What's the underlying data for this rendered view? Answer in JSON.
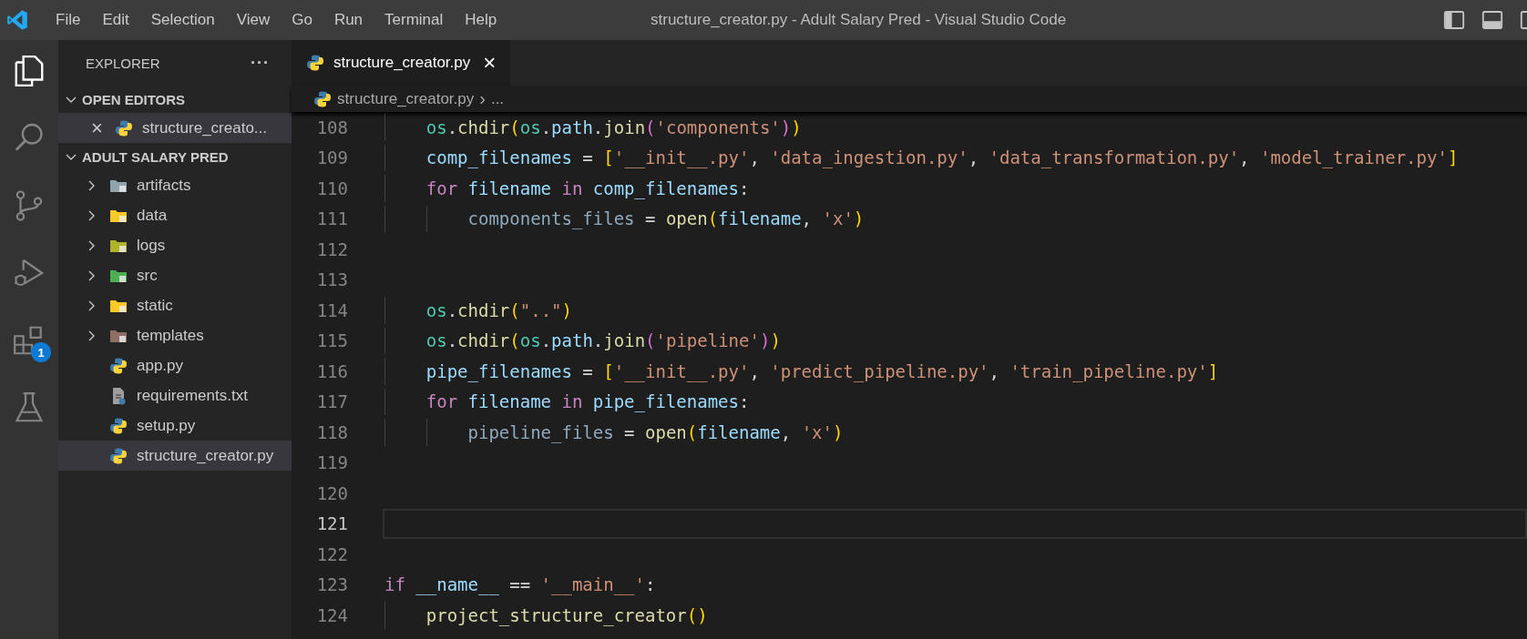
{
  "title_bar": {
    "menu": [
      "File",
      "Edit",
      "Selection",
      "View",
      "Go",
      "Run",
      "Terminal",
      "Help"
    ],
    "title": "structure_creator.py - Adult Salary Pred - Visual Studio Code"
  },
  "activity_bar": [
    {
      "kind": "explorer",
      "selected": true
    },
    {
      "kind": "search",
      "selected": false
    },
    {
      "kind": "source-control",
      "selected": false
    },
    {
      "kind": "run-debug",
      "selected": false
    },
    {
      "kind": "extensions",
      "selected": false,
      "badge": "1"
    },
    {
      "kind": "testing",
      "selected": false
    }
  ],
  "sidebar": {
    "title": "EXPLORER",
    "more": "···",
    "sections": [
      {
        "title": "OPEN EDITORS",
        "expanded": true,
        "items": [
          {
            "kind": "python",
            "label": "structure_creato...",
            "close": "×",
            "hovered": true
          }
        ]
      },
      {
        "title": "ADULT SALARY PRED",
        "expanded": true,
        "items": [
          {
            "kind": "folder",
            "label": "artifacts",
            "expanded": false,
            "color": "#90a4ae",
            "selected": false
          },
          {
            "kind": "folder",
            "label": "data",
            "expanded": false,
            "color": "#ffca28",
            "selected": false
          },
          {
            "kind": "folder",
            "label": "logs",
            "expanded": false,
            "color": "#afb42b",
            "selected": false
          },
          {
            "kind": "folder",
            "label": "src",
            "expanded": false,
            "color": "#4caf50",
            "selected": false
          },
          {
            "kind": "folder",
            "label": "static",
            "expanded": false,
            "color": "#ffca28",
            "selected": false
          },
          {
            "kind": "folder",
            "label": "templates",
            "expanded": false,
            "color": "#8d6e63",
            "selected": false
          },
          {
            "kind": "python",
            "label": "app.py",
            "selected": false
          },
          {
            "kind": "text",
            "label": "requirements.txt",
            "selected": false
          },
          {
            "kind": "python",
            "label": "setup.py",
            "selected": false
          },
          {
            "kind": "python",
            "label": "structure_creator.py",
            "selected": true
          }
        ]
      }
    ]
  },
  "tabs": [
    {
      "label": "structure_creator.py",
      "close": "×",
      "selected": true
    }
  ],
  "breadcrumbs": {
    "file": "structure_creator.py",
    "separator": "›",
    "rest": "..."
  },
  "code_lines": [
    {
      "number": "108",
      "current": false,
      "tokens": [
        {
          "text": "    os",
          "kind": "module"
        },
        {
          "text": ".",
          "kind": "punct"
        },
        {
          "text": "chdir",
          "kind": "func"
        },
        {
          "text": "(",
          "kind": "bracket1"
        },
        {
          "text": "os",
          "kind": "module"
        },
        {
          "text": ".",
          "kind": "punct"
        },
        {
          "text": "path",
          "kind": "var"
        },
        {
          "text": ".",
          "kind": "punct"
        },
        {
          "text": "join",
          "kind": "func"
        },
        {
          "text": "(",
          "kind": "bracket2"
        },
        {
          "text": "'components'",
          "kind": "str"
        },
        {
          "text": ")",
          "kind": "bracket2"
        },
        {
          "text": ")",
          "kind": "bracket1"
        }
      ]
    },
    {
      "number": "109",
      "current": false,
      "tokens": [
        {
          "text": "    comp_filenames",
          "kind": "var"
        },
        {
          "text": " = ",
          "kind": "punct"
        },
        {
          "text": "[",
          "kind": "bracket1"
        },
        {
          "text": "'__init__.py'",
          "kind": "str"
        },
        {
          "text": ", ",
          "kind": "punct"
        },
        {
          "text": "'data_ingestion.py'",
          "kind": "str"
        },
        {
          "text": ", ",
          "kind": "punct"
        },
        {
          "text": "'data_transformation.py'",
          "kind": "str"
        },
        {
          "text": ", ",
          "kind": "punct"
        },
        {
          "text": "'model_trainer.py'",
          "kind": "str"
        },
        {
          "text": "]",
          "kind": "bracket1"
        }
      ]
    },
    {
      "number": "110",
      "current": false,
      "tokens": [
        {
          "text": "    for",
          "kind": "keyword"
        },
        {
          "text": " filename ",
          "kind": "var"
        },
        {
          "text": "in",
          "kind": "keyword"
        },
        {
          "text": " comp_filenames",
          "kind": "var"
        },
        {
          "text": ":",
          "kind": "punct"
        }
      ]
    },
    {
      "number": "111",
      "current": false,
      "tokens": [
        {
          "text": "        components_files",
          "kind": "unused"
        },
        {
          "text": " = ",
          "kind": "punct"
        },
        {
          "text": "open",
          "kind": "func"
        },
        {
          "text": "(",
          "kind": "bracket1"
        },
        {
          "text": "filename",
          "kind": "var"
        },
        {
          "text": ", ",
          "kind": "punct"
        },
        {
          "text": "'x'",
          "kind": "str"
        },
        {
          "text": ")",
          "kind": "bracket1"
        }
      ]
    },
    {
      "number": "112",
      "current": false
    },
    {
      "number": "113",
      "current": false
    },
    {
      "number": "114",
      "current": false,
      "tokens": [
        {
          "text": "    os",
          "kind": "module"
        },
        {
          "text": ".",
          "kind": "punct"
        },
        {
          "text": "chdir",
          "kind": "func"
        },
        {
          "text": "(",
          "kind": "bracket1"
        },
        {
          "text": "\"..\"",
          "kind": "str"
        },
        {
          "text": ")",
          "kind": "bracket1"
        }
      ]
    },
    {
      "number": "115",
      "current": false,
      "tokens": [
        {
          "text": "    os",
          "kind": "module"
        },
        {
          "text": ".",
          "kind": "punct"
        },
        {
          "text": "chdir",
          "kind": "func"
        },
        {
          "text": "(",
          "kind": "bracket1"
        },
        {
          "text": "os",
          "kind": "module"
        },
        {
          "text": ".",
          "kind": "punct"
        },
        {
          "text": "path",
          "kind": "var"
        },
        {
          "text": ".",
          "kind": "punct"
        },
        {
          "text": "join",
          "kind": "func"
        },
        {
          "text": "(",
          "kind": "bracket2"
        },
        {
          "text": "'pipeline'",
          "kind": "str"
        },
        {
          "text": ")",
          "kind": "bracket2"
        },
        {
          "text": ")",
          "kind": "bracket1"
        }
      ]
    },
    {
      "number": "116",
      "current": false,
      "tokens": [
        {
          "text": "    pipe_filenames",
          "kind": "var"
        },
        {
          "text": " = ",
          "kind": "punct"
        },
        {
          "text": "[",
          "kind": "bracket1"
        },
        {
          "text": "'__init__.py'",
          "kind": "str"
        },
        {
          "text": ", ",
          "kind": "punct"
        },
        {
          "text": "'predict_pipeline.py'",
          "kind": "str"
        },
        {
          "text": ", ",
          "kind": "punct"
        },
        {
          "text": "'train_pipeline.py'",
          "kind": "str"
        },
        {
          "text": "]",
          "kind": "bracket1"
        }
      ]
    },
    {
      "number": "117",
      "current": false,
      "tokens": [
        {
          "text": "    for",
          "kind": "keyword"
        },
        {
          "text": " filename ",
          "kind": "var"
        },
        {
          "text": "in",
          "kind": "keyword"
        },
        {
          "text": " pipe_filenames",
          "kind": "var"
        },
        {
          "text": ":",
          "kind": "punct"
        }
      ]
    },
    {
      "number": "118",
      "current": false,
      "tokens": [
        {
          "text": "        pipeline_files",
          "kind": "unused"
        },
        {
          "text": " = ",
          "kind": "punct"
        },
        {
          "text": "open",
          "kind": "func"
        },
        {
          "text": "(",
          "kind": "bracket1"
        },
        {
          "text": "filename",
          "kind": "var"
        },
        {
          "text": ", ",
          "kind": "punct"
        },
        {
          "text": "'x'",
          "kind": "str"
        },
        {
          "text": ")",
          "kind": "bracket1"
        }
      ]
    },
    {
      "number": "119",
      "current": false
    },
    {
      "number": "120",
      "current": false
    },
    {
      "number": "121",
      "current": true
    },
    {
      "number": "122",
      "current": false
    },
    {
      "number": "123",
      "current": false,
      "tokens": [
        {
          "text": "if",
          "kind": "keyword"
        },
        {
          "text": " __name__",
          "kind": "var"
        },
        {
          "text": " == ",
          "kind": "punct"
        },
        {
          "text": "'__main__'",
          "kind": "str"
        },
        {
          "text": ":",
          "kind": "punct"
        }
      ]
    },
    {
      "number": "124",
      "current": false,
      "tokens": [
        {
          "text": "    project_structure_creator",
          "kind": "func"
        },
        {
          "text": "()",
          "kind": "bracket1"
        }
      ]
    }
  ]
}
